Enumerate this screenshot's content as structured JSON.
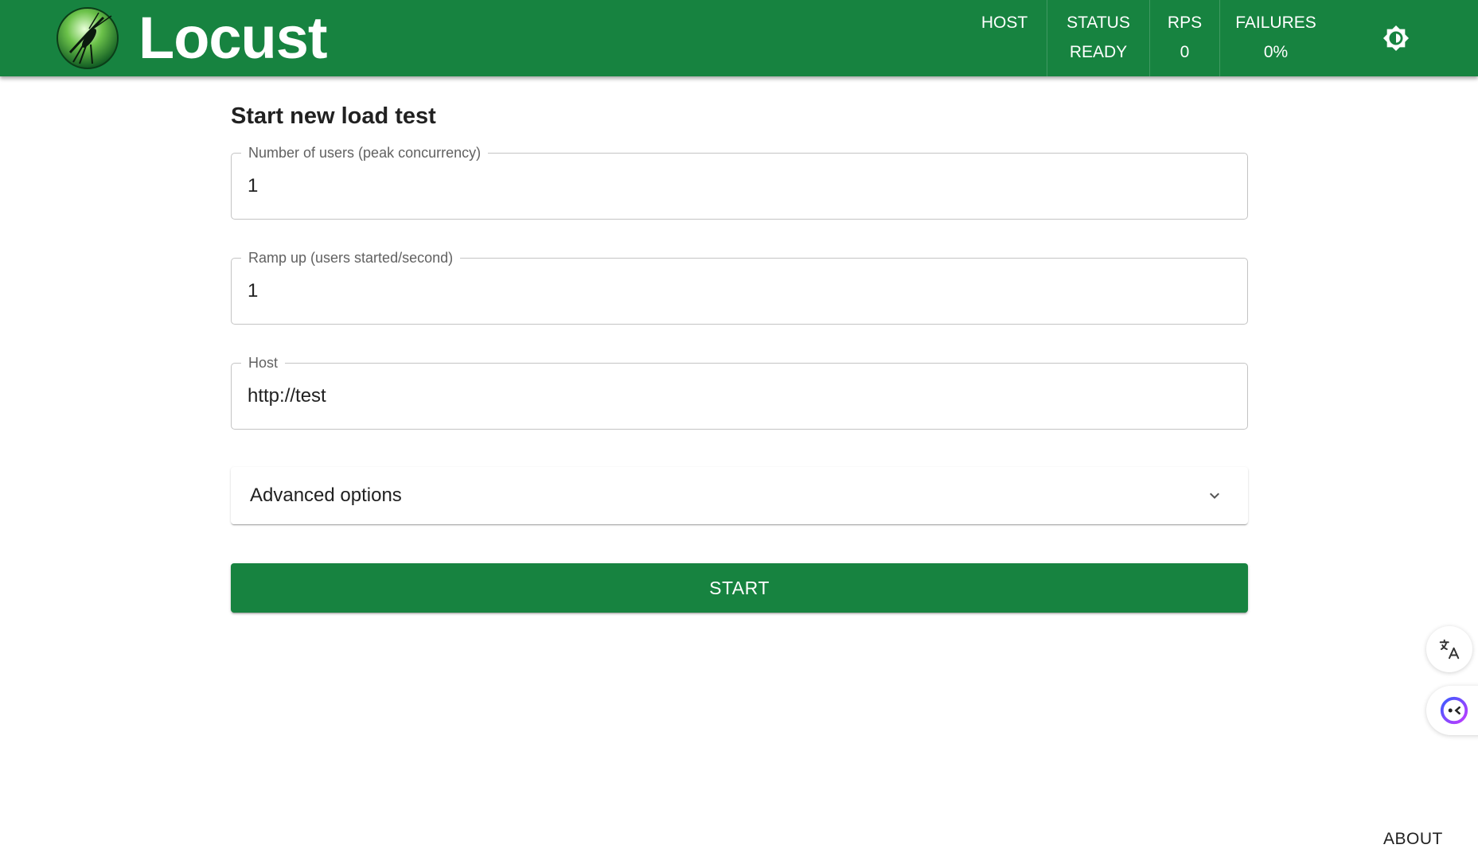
{
  "header": {
    "brand_name": "Locust",
    "logo_icon": "locust-logo-icon",
    "theme_toggle_icon": "brightness-icon",
    "stats": {
      "host": {
        "label": "HOST",
        "value": ""
      },
      "status": {
        "label": "STATUS",
        "value": "READY"
      },
      "rps": {
        "label": "RPS",
        "value": "0"
      },
      "failures": {
        "label": "FAILURES",
        "value": "0%"
      }
    }
  },
  "form": {
    "title": "Start new load test",
    "users": {
      "label": "Number of users (peak concurrency)",
      "value": "1"
    },
    "ramp_up": {
      "label": "Ramp up (users started/second)",
      "value": "1"
    },
    "host": {
      "label": "Host",
      "value": "http://test"
    },
    "advanced_options": {
      "label": "Advanced options",
      "icon": "chevron-down-icon"
    },
    "start_label": "START"
  },
  "floating_buttons": {
    "translate_icon": "translate-icon",
    "assistant_icon": "assistant-icon"
  },
  "footer": {
    "about_label": "ABOUT"
  },
  "colors": {
    "primary": "#178340",
    "outline": "#c4c4c4",
    "text": "#212121",
    "label_text": "#616161"
  }
}
